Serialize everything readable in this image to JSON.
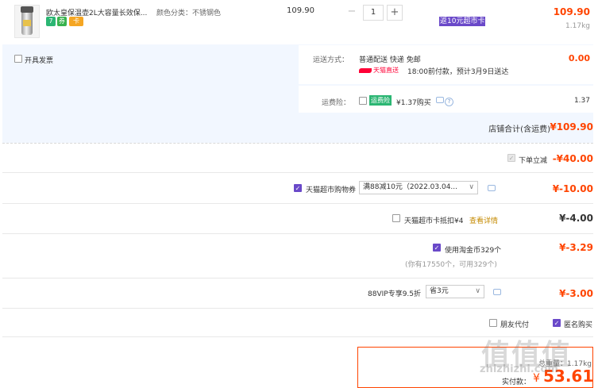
{
  "item": {
    "title": "欧太皇保温壶2L大容量长效保...",
    "spec": "颜色分类：不锈钢色",
    "badges": [
      "7",
      "券",
      "卡"
    ],
    "unit_price": "109.90",
    "quantity": "1",
    "minus": "−",
    "plus": "+",
    "promo": "返10元超市卡",
    "subtotal": "109.90",
    "weight": "1.17kg"
  },
  "invoice": {
    "label": "开具发票"
  },
  "shipping": {
    "label": "运送方式：",
    "method": "普通配送 快递 免邮",
    "fee": "0.00",
    "brand": "天猫直送",
    "eta": "18:00前付款，预计3月9日送达"
  },
  "insurance": {
    "label": "运费险：",
    "tag": "运费险",
    "price_text": "¥1.37购买",
    "amount": "1.37"
  },
  "shop_total": {
    "label": "店铺合计(含运费)",
    "amount": "¥109.90"
  },
  "discounts": [
    {
      "label": "下单立减",
      "amount": "-¥40.00"
    },
    {
      "label": "天猫超市购物券",
      "select": "满88减10元（2022.03.04...",
      "amount": "¥-10.00"
    },
    {
      "label": "天猫超市卡抵扣¥4",
      "link": "查看详情",
      "amount": "¥-4.00"
    },
    {
      "label": "使用淘金币329个",
      "sub": "(你有17550个，可用329个)",
      "amount": "¥-3.29"
    },
    {
      "label": "88VIP专享9.5折",
      "select": "省3元",
      "amount": "¥-3.00"
    }
  ],
  "options": {
    "friend_pay": "朋友代付",
    "anonymous": "匿名购买"
  },
  "summary": {
    "weight": "总重量：1.17kg",
    "pay_label": "实付款：",
    "currency": "¥",
    "pay_amount": "53.61"
  },
  "watermark": {
    "logo": "值值值",
    "url": "zhizhizhi.com"
  },
  "colors": {
    "accent": "#ff4400",
    "purple": "#6a49c9",
    "light_blue": "#f2f7ff"
  }
}
